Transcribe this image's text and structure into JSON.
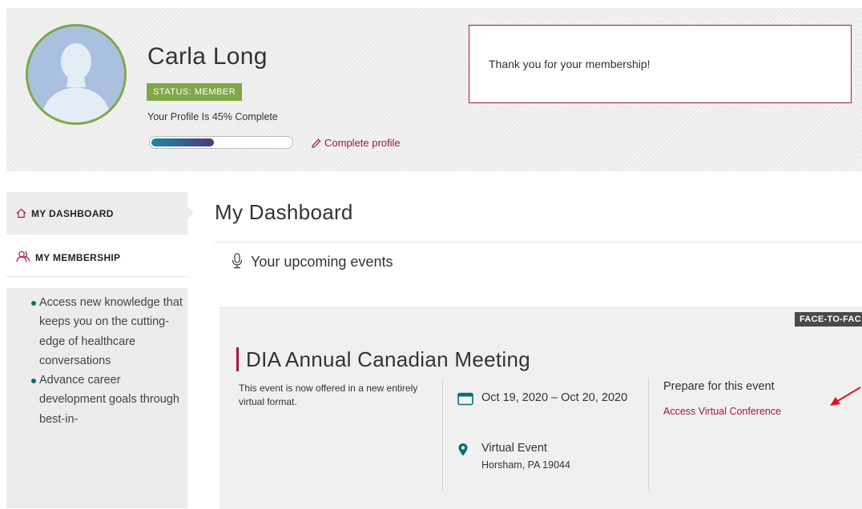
{
  "profile": {
    "name": "Carla Long",
    "status": "STATUS: MEMBER",
    "completion_text": "Your Profile Is 45% Complete",
    "completion_percent": 45,
    "complete_link": "Complete profile"
  },
  "notice": {
    "message": "Thank you for your membership!"
  },
  "sidebar": {
    "items": [
      {
        "label": "MY DASHBOARD",
        "icon": "home-icon",
        "active": true
      },
      {
        "label": "MY MEMBERSHIP",
        "icon": "members-icon",
        "active": false
      }
    ],
    "benefits": [
      "Access new knowledge that keeps you on the cutting-edge of healthcare conversations",
      "Advance career development goals through best-in-"
    ]
  },
  "main": {
    "title": "My Dashboard",
    "upcoming_heading": "Your upcoming events"
  },
  "event": {
    "tag": "FACE-TO-FAC",
    "title": "DIA Annual Canadian Meeting",
    "description": "This event is now offered in a new entirely virtual format.",
    "date": "Oct 19, 2020 – Oct 20, 2020",
    "location_name": "Virtual Event",
    "location_address": "Horsham, PA 19044",
    "prepare_heading": "Prepare for this event",
    "access_link": "Access Virtual Conference"
  },
  "colors": {
    "accent": "#a3154d",
    "status_green": "#7fa749",
    "teal": "#0b6e75",
    "annotation_arrow": "#e0141e"
  }
}
